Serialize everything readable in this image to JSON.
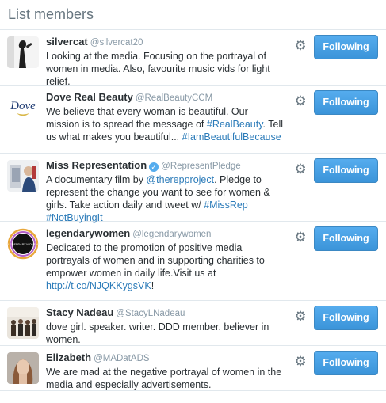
{
  "header": {
    "title": "List members"
  },
  "members": [
    {
      "name": "silvercat",
      "handle": "@silvercat20",
      "bio": [
        {
          "t": "Looking at the media. Focusing on the portrayal of women in media. Also, favourite music vids for light relief.",
          "link": false
        }
      ],
      "verified": false,
      "button_label": "Following"
    },
    {
      "name": "Dove Real Beauty",
      "handle": "@RealBeautyCCM",
      "bio": [
        {
          "t": "We believe that every woman is beautiful. Our mission is to spread the message of ",
          "link": false
        },
        {
          "t": "#RealBeauty",
          "link": true
        },
        {
          "t": ". Tell us what makes you beautiful... ",
          "link": false
        },
        {
          "t": "#IamBeautifulBecause",
          "link": true
        }
      ],
      "verified": false,
      "button_label": "Following"
    },
    {
      "name": "Miss Representation",
      "handle": "@RepresentPledge",
      "bio": [
        {
          "t": "A documentary film by ",
          "link": false
        },
        {
          "t": "@therepproject",
          "link": true
        },
        {
          "t": ". Pledge to represent the change you want to see for women & girls. Take action daily and tweet w/ ",
          "link": false
        },
        {
          "t": "#MissRep",
          "link": true
        },
        {
          "t": " ",
          "link": false
        },
        {
          "t": "#NotBuyingIt",
          "link": true
        }
      ],
      "verified": true,
      "button_label": "Following"
    },
    {
      "name": "legendarywomen",
      "handle": "@legendarywomen",
      "bio": [
        {
          "t": "Dedicated to the promotion of positive media portrayals of women and in supporting charities to empower women in daily life.Visit us at ",
          "link": false
        },
        {
          "t": "http://t.co/NJQKKygsVK",
          "link": true
        },
        {
          "t": "!",
          "link": false
        }
      ],
      "verified": false,
      "button_label": "Following"
    },
    {
      "name": "Stacy Nadeau",
      "handle": "@StacyLNadeau",
      "bio": [
        {
          "t": "dove girl. speaker. writer. DDD member. believer in women.",
          "link": false
        }
      ],
      "verified": false,
      "button_label": "Following"
    },
    {
      "name": "Elizabeth",
      "handle": "@MADatADS",
      "bio": [
        {
          "t": "We are mad at the negative portrayal of women in the media and especially advertisements.",
          "link": false
        }
      ],
      "verified": false,
      "button_label": "Following"
    }
  ],
  "avatar_text": {
    "dove": "Dove",
    "legendary": "LEGENDARY WOMEN"
  },
  "icons": {
    "gear": "gear-icon",
    "verified": "verified-badge-icon"
  },
  "colors": {
    "button": "#3b94d9",
    "link": "#2b7bb9",
    "handle": "#8899a6"
  }
}
